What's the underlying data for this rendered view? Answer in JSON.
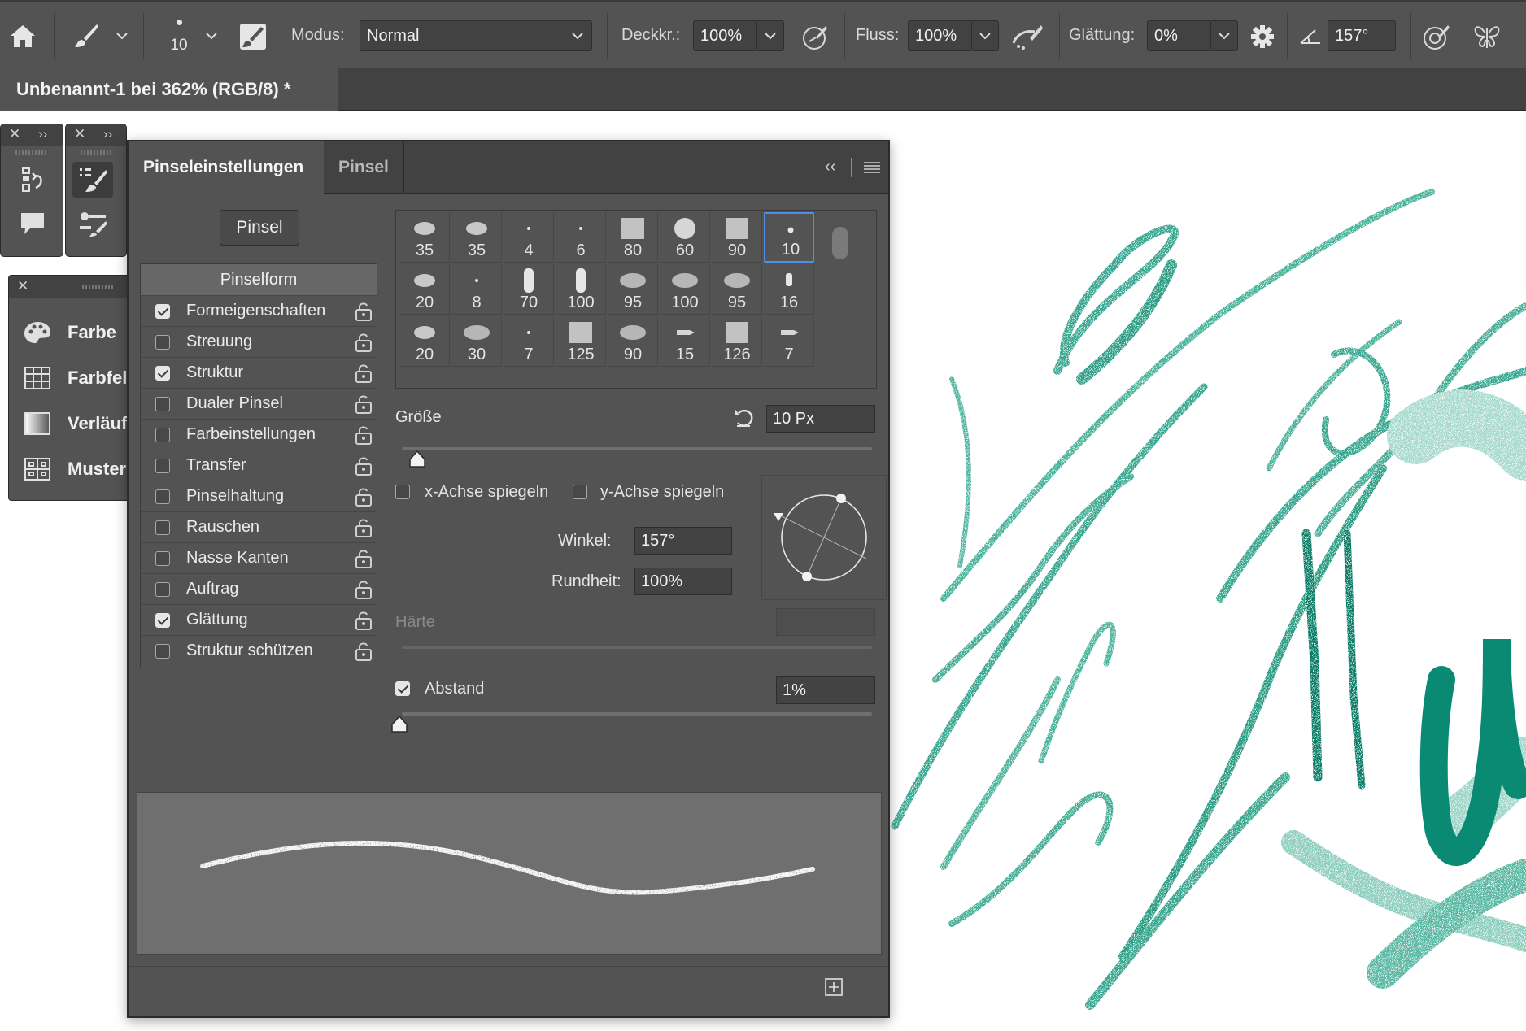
{
  "options_bar": {
    "brush_size": "10",
    "mode_label": "Modus:",
    "mode_value": "Normal",
    "opacity_label": "Deckkr.:",
    "opacity_value": "100%",
    "flow_label": "Fluss:",
    "flow_value": "100%",
    "smoothing_label": "Glättung:",
    "smoothing_value": "0%",
    "angle_value": "157°"
  },
  "document_tab": {
    "title": "Unbenannt-1 bei 362% (RGB/8) *"
  },
  "color_panel": {
    "items": [
      {
        "label": "Farbe",
        "icon": "palette-icon"
      },
      {
        "label": "Farbfel",
        "icon": "swatches-icon"
      },
      {
        "label": "Verläuf",
        "icon": "gradient-icon"
      },
      {
        "label": "Muster",
        "icon": "pattern-icon"
      }
    ]
  },
  "brush_settings": {
    "tabs": [
      "Pinseleinstellungen",
      "Pinsel"
    ],
    "brushes_button": "Pinsel",
    "list_header": "Pinselform",
    "properties": [
      {
        "label": "Formeigenschaften",
        "checked": true
      },
      {
        "label": "Streuung",
        "checked": false
      },
      {
        "label": "Struktur",
        "checked": true
      },
      {
        "label": "Dualer Pinsel",
        "checked": false
      },
      {
        "label": "Farbeinstellungen",
        "checked": false
      },
      {
        "label": "Transfer",
        "checked": false
      },
      {
        "label": "Pinselhaltung",
        "checked": false
      },
      {
        "label": "Rauschen",
        "checked": false
      },
      {
        "label": "Nasse Kanten",
        "checked": false
      },
      {
        "label": "Auftrag",
        "checked": false
      },
      {
        "label": "Glättung",
        "checked": true
      },
      {
        "label": "Struktur schützen",
        "checked": false
      }
    ],
    "brush_grid": [
      [
        "35",
        "35",
        "4",
        "6",
        "80",
        "60",
        "90",
        "10"
      ],
      [
        "20",
        "8",
        "70",
        "100",
        "95",
        "100",
        "95",
        "16"
      ],
      [
        "20",
        "30",
        "7",
        "125",
        "90",
        "15",
        "126",
        "7"
      ]
    ],
    "selected_brush": "10",
    "size_label": "Größe",
    "size_value": "10 Px",
    "flip_x_label": "x-Achse spiegeln",
    "flip_y_label": "y-Achse spiegeln",
    "angle_label": "Winkel:",
    "angle_value": "157°",
    "roundness_label": "Rundheit:",
    "roundness_value": "100%",
    "hardness_label": "Härte",
    "hardness_value": "",
    "spacing_label": "Abstand",
    "spacing_value": "1%",
    "spacing_checked": true
  },
  "colors": {
    "ui_dark": "#424242",
    "ui_panel": "#535353",
    "accent_blue": "#4d90e6",
    "stroke_teal": "#0b8a73"
  }
}
